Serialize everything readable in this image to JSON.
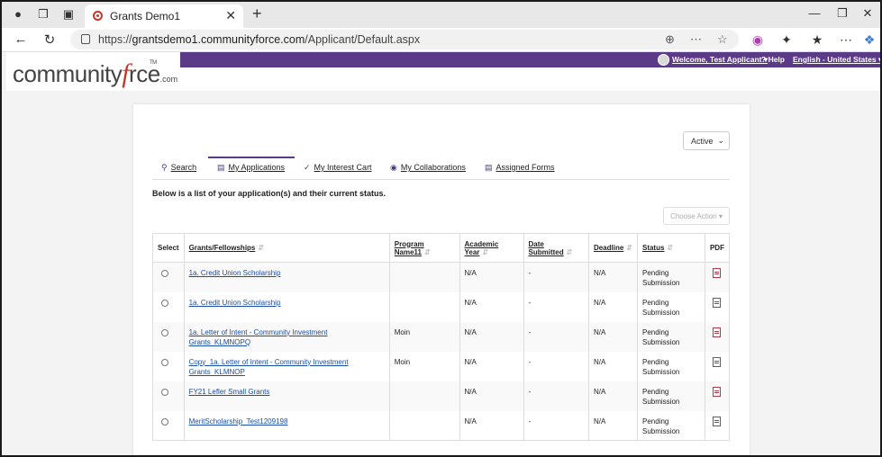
{
  "browser": {
    "tab_title": "Grants Demo1",
    "url_prefix": "https://",
    "url_host": "grantsdemo1.communityforce.com",
    "url_path": "/Applicant/Default.aspx"
  },
  "header": {
    "welcome": "Welcome, Test Applicant",
    "help": "Help",
    "language": "English - United States",
    "logo_text_1": "community",
    "logo_text_f": "f",
    "logo_text_2": "rce",
    "logo_dotcom": ".com",
    "logo_tm": "TM"
  },
  "filter": {
    "selected": "Active"
  },
  "tabs": [
    {
      "label": "Search",
      "icon": "search-icon"
    },
    {
      "label": "My Applications",
      "icon": "card-icon"
    },
    {
      "label": "My Interest Cart",
      "icon": "cart-icon"
    },
    {
      "label": "My Collaborations",
      "icon": "users-icon"
    },
    {
      "label": "Assigned Forms",
      "icon": "form-icon"
    }
  ],
  "intro": "Below is a list of your application(s) and their current status.",
  "choose_action": "Choose Action",
  "table": {
    "headers": {
      "select": "Select",
      "grants": "Grants/Fellowships",
      "program_1": "Program",
      "program_2": "Name11",
      "academic_1": "Academic",
      "academic_2": "Year",
      "date_1": "Date",
      "date_2": "Submitted",
      "deadline": "Deadline",
      "status": "Status",
      "pdf": "PDF"
    },
    "rows": [
      {
        "grant": "1a. Credit Union Scholarship",
        "grant_2": "",
        "program": "",
        "year": "N/A",
        "date": "-",
        "deadline": "N/A",
        "status_1": "Pending",
        "status_2": "Submission"
      },
      {
        "grant": "1a. Credit Union Scholarship",
        "grant_2": "",
        "program": "",
        "year": "N/A",
        "date": "-",
        "deadline": "N/A",
        "status_1": "Pending",
        "status_2": "Submission"
      },
      {
        "grant": "1a. Letter of Intent - Community Investment Grants_KLMNOPQ",
        "grant_2": "",
        "program": "Moin",
        "year": "N/A",
        "date": "-",
        "deadline": "N/A",
        "status_1": "Pending",
        "status_2": "Submission"
      },
      {
        "grant": "Copy_1a. Letter of Intent - Community Investment",
        "grant_2": "Grants_KLMNOP",
        "program": "Moin",
        "year": "N/A",
        "date": "-",
        "deadline": "N/A",
        "status_1": "Pending",
        "status_2": "Submission"
      },
      {
        "grant": "FY21 Lefler Small Grants",
        "grant_2": "",
        "program": "",
        "year": "N/A",
        "date": "-",
        "deadline": "N/A",
        "status_1": "Pending",
        "status_2": "Submission"
      },
      {
        "grant": "MeritScholarship_Test1209198",
        "grant_2": "",
        "program": "",
        "year": "N/A",
        "date": "-",
        "deadline": "N/A",
        "status_1": "Pending",
        "status_2": "Submission"
      }
    ]
  }
}
